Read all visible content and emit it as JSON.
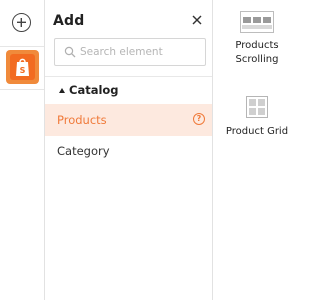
{
  "panel": {
    "title": "Add",
    "search_placeholder": "Search element",
    "category": {
      "label": "Catalog",
      "items": [
        {
          "label": "Products",
          "selected": true
        },
        {
          "label": "Category",
          "selected": false
        }
      ]
    }
  },
  "elements": [
    {
      "label_line1": "Products",
      "label_line2": "Scrolling",
      "icon": "products-scrolling-icon"
    },
    {
      "label_line1": "Product Grid",
      "icon": "product-grid-icon"
    }
  ],
  "colors": {
    "accent": "#f07a3a",
    "selected_bg": "#fde9df",
    "app_icon_bg": "#f26b21"
  },
  "help_glyph": "?"
}
